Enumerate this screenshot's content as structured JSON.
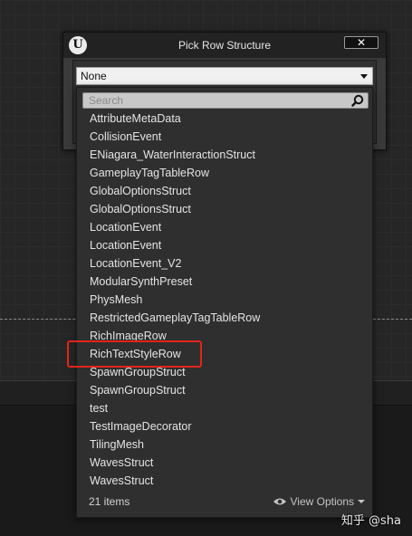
{
  "dialog": {
    "title": "Pick Row Structure",
    "logo_text": "U",
    "close_label": "✕"
  },
  "combo": {
    "selected": "None"
  },
  "dropdown": {
    "search_placeholder": "Search",
    "items": [
      "AttributeMetaData",
      "CollisionEvent",
      "ENiagara_WaterInteractionStruct",
      "GameplayTagTableRow",
      "GlobalOptionsStruct",
      "GlobalOptionsStruct",
      "LocationEvent",
      "LocationEvent",
      "LocationEvent_V2",
      "ModularSynthPreset",
      "PhysMesh",
      "RestrictedGameplayTagTableRow",
      "RichImageRow",
      "RichTextStyleRow",
      "SpawnGroupStruct",
      "SpawnGroupStruct",
      "test",
      "TestImageDecorator",
      "TilingMesh",
      "WavesStruct",
      "WavesStruct"
    ],
    "highlighted_item": "RichTextStyleRow",
    "count_label": "21 items",
    "view_options_label": "View Options"
  },
  "watermark": "知乎 @sha",
  "colors": {
    "highlight_border": "#e1251b",
    "panel_bg": "#2f2f2f",
    "titlebar_bg": "#222222"
  },
  "icons": [
    "unreal-logo-icon",
    "close-icon",
    "chevron-down-icon",
    "search-icon",
    "eye-icon"
  ]
}
